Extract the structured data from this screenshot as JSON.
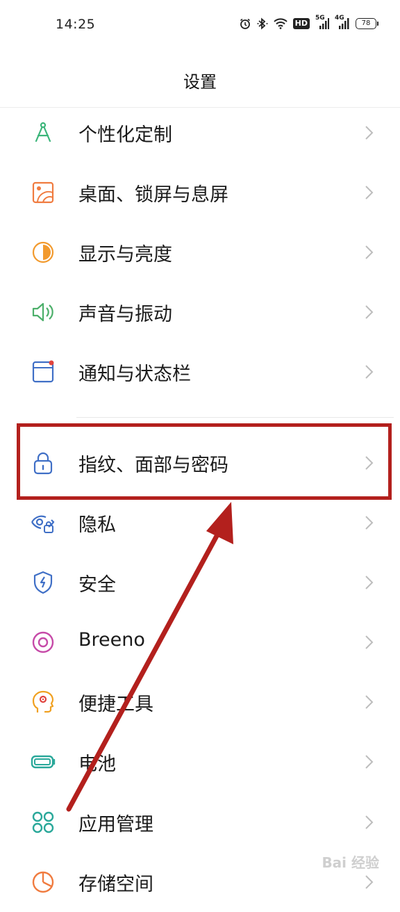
{
  "status_bar": {
    "time": "14:25",
    "icons": [
      "alarm-icon",
      "bluetooth-icon",
      "wifi-icon",
      "hd-icon",
      "signal-5g-icon",
      "signal-4g-icon",
      "battery-icon"
    ],
    "hd_label": "HD",
    "net1_label": "5G",
    "net2_label": "4G",
    "battery_level": "78"
  },
  "header": {
    "title": "设置"
  },
  "settings": {
    "items": [
      {
        "label": "个性化定制",
        "icon": "compass-icon",
        "color": "#3bb57a"
      },
      {
        "label": "桌面、锁屏与息屏",
        "icon": "wallpaper-icon",
        "color": "#f07b3f"
      },
      {
        "label": "显示与亮度",
        "icon": "brightness-icon",
        "color": "#f29a2e"
      },
      {
        "label": "声音与振动",
        "icon": "speaker-icon",
        "color": "#4caf6a"
      },
      {
        "label": "通知与状态栏",
        "icon": "notification-icon",
        "color": "#3f6fc6"
      },
      {
        "label": "指纹、面部与密码",
        "icon": "lock-icon",
        "color": "#3f6fc6"
      },
      {
        "label": "隐私",
        "icon": "privacy-eye-icon",
        "color": "#3f6fc6"
      },
      {
        "label": "安全",
        "icon": "shield-icon",
        "color": "#3f6fc6"
      },
      {
        "label": "Breeno",
        "icon": "breeno-icon",
        "color": "#c64aa8"
      },
      {
        "label": "便捷工具",
        "icon": "head-icon",
        "color": "#f0a020"
      },
      {
        "label": "电池",
        "icon": "battery-icon",
        "color": "#2aa89a"
      },
      {
        "label": "应用管理",
        "icon": "apps-icon",
        "color": "#2aa89a"
      },
      {
        "label": "存储空间",
        "icon": "storage-icon",
        "color": "#f07b3f"
      }
    ]
  },
  "annotation": {
    "highlight_color": "#b3201d"
  },
  "watermark": {
    "text": "Bai 经验"
  }
}
